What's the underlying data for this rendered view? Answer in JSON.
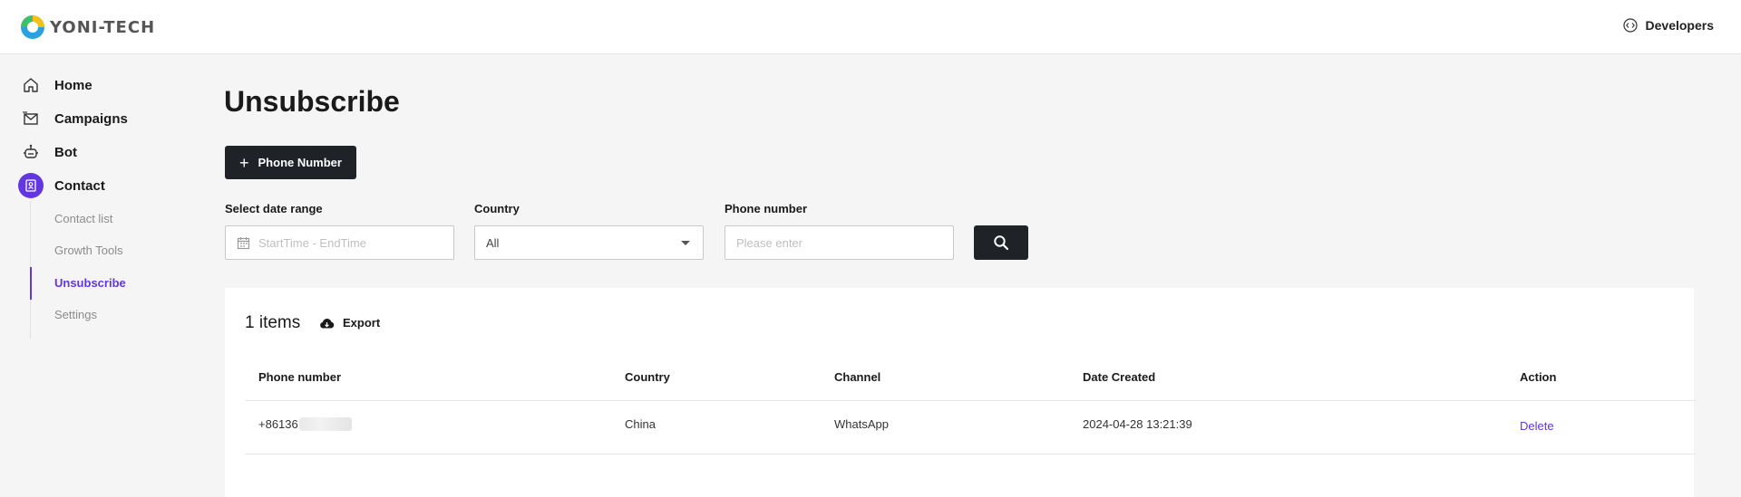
{
  "header": {
    "logo_text": "YONI-TECH",
    "developers_label": "Developers"
  },
  "sidebar": {
    "items": [
      {
        "label": "Home",
        "icon": "home-icon"
      },
      {
        "label": "Campaigns",
        "icon": "mail-icon"
      },
      {
        "label": "Bot",
        "icon": "robot-icon"
      },
      {
        "label": "Contact",
        "icon": "contact-card-icon",
        "active": true
      }
    ],
    "sub_items": [
      {
        "label": "Contact list"
      },
      {
        "label": "Growth Tools"
      },
      {
        "label": "Unsubscribe",
        "active": true
      },
      {
        "label": "Settings"
      }
    ]
  },
  "main": {
    "title": "Unsubscribe",
    "add_button_label": "Phone Number",
    "filters": {
      "date_label": "Select date range",
      "date_placeholder": "StartTime - EndTime",
      "country_label": "Country",
      "country_value": "All",
      "phone_label": "Phone number",
      "phone_placeholder": "Please enter"
    },
    "table": {
      "count_text": "1 items",
      "export_label": "Export",
      "columns": [
        "Phone number",
        "Country",
        "Channel",
        "Date Created",
        "Action"
      ],
      "rows": [
        {
          "phone": "+86136",
          "country": "China",
          "channel": "WhatsApp",
          "date_created": "2024-04-28 13:21:39",
          "action": "Delete"
        }
      ]
    }
  },
  "colors": {
    "accent": "#6236e0",
    "dark_button": "#1f2226",
    "background": "#f5f5f5"
  }
}
